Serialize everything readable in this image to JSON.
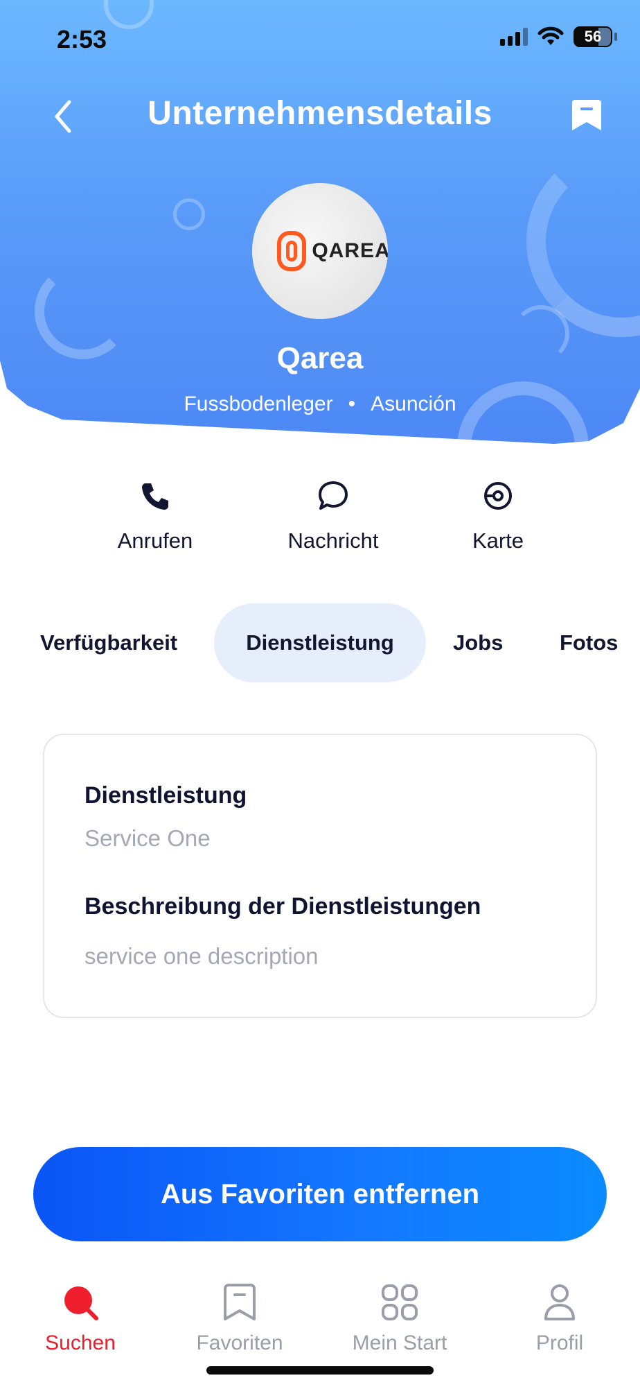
{
  "status_bar": {
    "time": "2:53",
    "battery": "56"
  },
  "header": {
    "title": "Unternehmensdetails"
  },
  "company": {
    "logo_text": "QAREA",
    "name": "Qarea",
    "category": "Fussbodenleger",
    "separator": "•",
    "location": "Asunción"
  },
  "actions": [
    {
      "label": "Anrufen",
      "icon": "phone-icon"
    },
    {
      "label": "Nachricht",
      "icon": "chat-bubble-icon"
    },
    {
      "label": "Karte",
      "icon": "location-icon"
    }
  ],
  "tabs": [
    {
      "label": "Verfügbarkeit",
      "active": false
    },
    {
      "label": "Dienstleistung",
      "active": true
    },
    {
      "label": "Jobs",
      "active": false
    },
    {
      "label": "Fotos",
      "active": false
    }
  ],
  "service_card": {
    "service_label": "Dienstleistung",
    "service_value": "Service One",
    "description_label": "Beschreibung der Dienstleistungen",
    "description_value": "service one description"
  },
  "cta": {
    "label": "Aus Favoriten entfernen"
  },
  "bottom_nav": [
    {
      "label": "Suchen",
      "icon": "search-icon",
      "active": true
    },
    {
      "label": "Favoriten",
      "icon": "bookmark-icon",
      "active": false
    },
    {
      "label": "Mein Start",
      "icon": "grid-icon",
      "active": false
    },
    {
      "label": "Profil",
      "icon": "profile-icon",
      "active": false
    }
  ],
  "colors": {
    "header_gradient_top": "#6cb8ff",
    "header_gradient_bottom": "#4d88f5",
    "accent_blue": "#0a55f6",
    "active_tab_bg": "#e6eefc",
    "nav_active": "#ee1e2d",
    "nav_inactive": "#9a9ea9"
  }
}
